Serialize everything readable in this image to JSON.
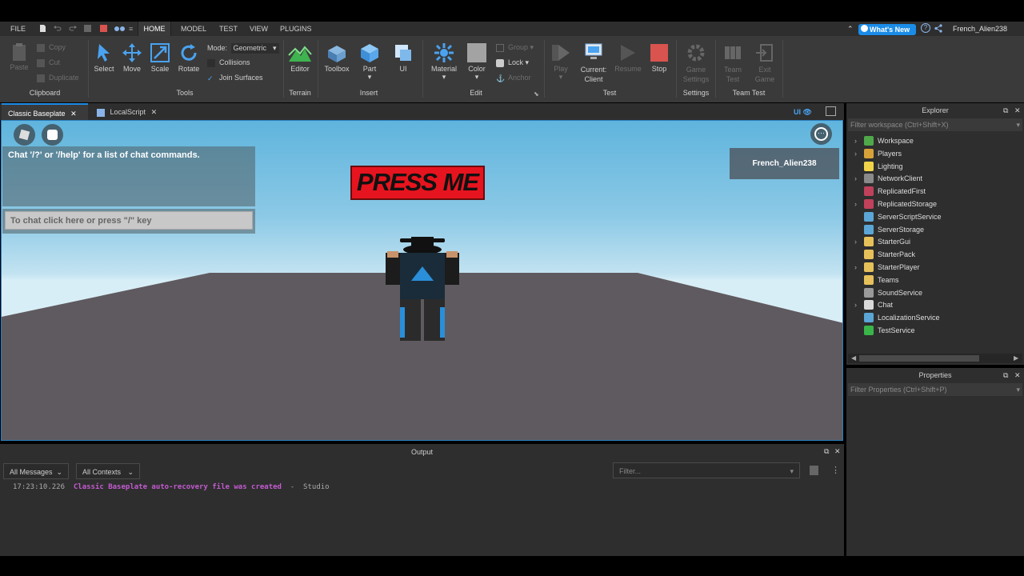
{
  "menubar": {
    "items": [
      "FILE",
      "HOME",
      "MODEL",
      "TEST",
      "VIEW",
      "PLUGINS"
    ],
    "whats_new": "What's New",
    "username": "French_Alien238"
  },
  "ribbon": {
    "clipboard": {
      "paste": "Paste",
      "copy": "Copy",
      "cut": "Cut",
      "duplicate": "Duplicate",
      "label": "Clipboard"
    },
    "tools": {
      "select": "Select",
      "move": "Move",
      "scale": "Scale",
      "rotate": "Rotate",
      "mode_label": "Mode:",
      "mode_value": "Geometric",
      "collisions": "Collisions",
      "join_surfaces": "Join Surfaces",
      "label": "Tools"
    },
    "terrain": {
      "editor": "Editor",
      "label": "Terrain"
    },
    "insert": {
      "toolbox": "Toolbox",
      "part": "Part",
      "ui": "UI",
      "label": "Insert"
    },
    "edit": {
      "material": "Material",
      "color": "Color",
      "group": "Group",
      "lock": "Lock",
      "anchor": "Anchor",
      "label": "Edit"
    },
    "test": {
      "play": "Play",
      "current_client_1": "Current:",
      "current_client_2": "Client",
      "resume": "Resume",
      "stop": "Stop",
      "label": "Test"
    },
    "settings": {
      "game_settings_1": "Game",
      "game_settings_2": "Settings",
      "label": "Settings"
    },
    "team_test": {
      "team_test_1": "Team",
      "team_test_2": "Test",
      "exit_game_1": "Exit",
      "exit_game_2": "Game",
      "label": "Team Test"
    }
  },
  "tabs": {
    "tab1": "Classic Baseplate",
    "tab2": "LocalScript",
    "ui_toggle": "UI"
  },
  "viewport": {
    "chat_message": "Chat '/?' or '/help' for a list of chat commands.",
    "chat_placeholder": "To chat click here or press \"/\" key",
    "press_me": "PRESS ME",
    "player_name": "French_Alien238"
  },
  "output": {
    "title": "Output",
    "messages_filter": "All Messages",
    "contexts_filter": "All Contexts",
    "filter_placeholder": "Filter...",
    "log_time": "17:23:10.226",
    "log_message": "Classic Baseplate auto-recovery file was created",
    "log_source": "  -  Studio"
  },
  "explorer": {
    "title": "Explorer",
    "filter_placeholder": "Filter workspace (Ctrl+Shift+X)",
    "items": [
      {
        "label": "Workspace",
        "chev": "›",
        "color": "#4fa84a"
      },
      {
        "label": "Players",
        "chev": "›",
        "color": "#d7a13a"
      },
      {
        "label": "Lighting",
        "chev": "",
        "color": "#f1d34a"
      },
      {
        "label": "NetworkClient",
        "chev": "›",
        "color": "#8a8a8a"
      },
      {
        "label": "ReplicatedFirst",
        "chev": "",
        "color": "#c0415b"
      },
      {
        "label": "ReplicatedStorage",
        "chev": "›",
        "color": "#c0415b"
      },
      {
        "label": "ServerScriptService",
        "chev": "",
        "color": "#5ba6d6"
      },
      {
        "label": "ServerStorage",
        "chev": "",
        "color": "#5ba6d6"
      },
      {
        "label": "StarterGui",
        "chev": "›",
        "color": "#e6c15a"
      },
      {
        "label": "StarterPack",
        "chev": "",
        "color": "#e6c15a"
      },
      {
        "label": "StarterPlayer",
        "chev": "›",
        "color": "#e6c15a"
      },
      {
        "label": "Teams",
        "chev": "",
        "color": "#e6c15a"
      },
      {
        "label": "SoundService",
        "chev": "",
        "color": "#9a9a9a"
      },
      {
        "label": "Chat",
        "chev": "›",
        "color": "#d9d9d9"
      },
      {
        "label": "LocalizationService",
        "chev": "",
        "color": "#5ba6d6"
      },
      {
        "label": "TestService",
        "chev": "",
        "color": "#39b54a"
      }
    ]
  },
  "properties": {
    "title": "Properties",
    "filter_placeholder": "Filter Properties (Ctrl+Shift+P)"
  }
}
